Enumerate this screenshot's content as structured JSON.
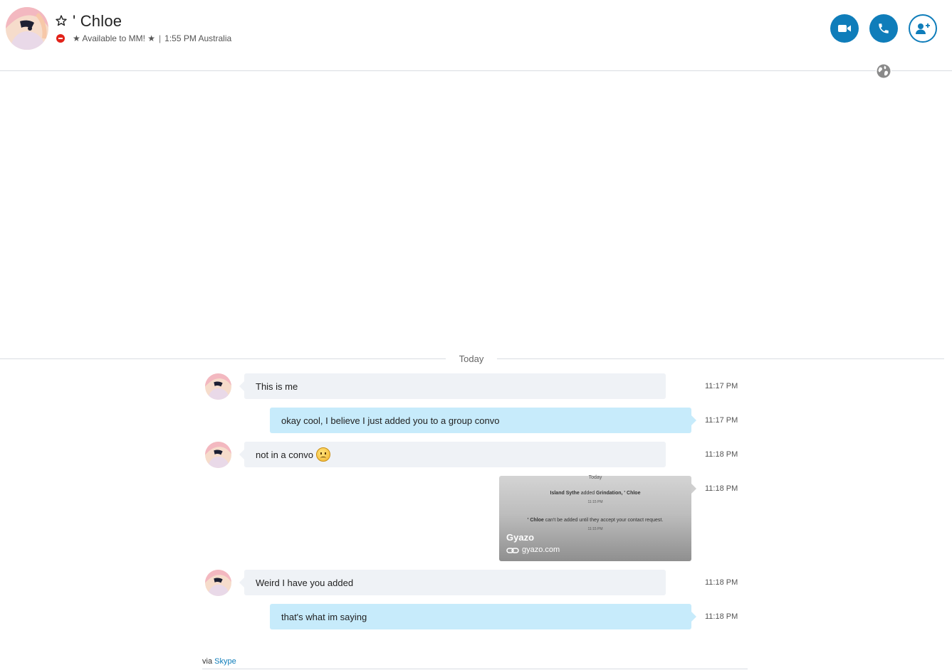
{
  "header": {
    "contact_name": "' Chloe",
    "mood": "★ Available to MM! ★",
    "separator": "|",
    "local_time": "1:55 PM Australia",
    "presence": "do-not-disturb",
    "buttons": [
      "video-call",
      "audio-call",
      "add-people"
    ]
  },
  "colors": {
    "accent": "#0f7dba",
    "incoming_bubble": "#eff2f6",
    "outgoing_bubble": "#c7ebfb",
    "presence_dnd": "#e2231a"
  },
  "conversation": {
    "day_label": "Today",
    "messages": [
      {
        "direction": "in",
        "text": "This is me",
        "time": "11:17 PM"
      },
      {
        "direction": "out",
        "text": "okay cool, I believe I just added you to a group convo",
        "time": "11:17 PM"
      },
      {
        "direction": "in",
        "text": "not in a convo",
        "emoticon": "sad-emoticon",
        "time": "11:18 PM"
      },
      {
        "direction": "out",
        "type": "link-preview",
        "title": "Gyazo",
        "domain": "gyazo.com",
        "time": "11:18 PM",
        "thumbnail": {
          "line1": "Today",
          "line2_a": "Island Sythe",
          "line2_b": "added",
          "line2_c": "Grindation",
          "line2_d": ", ' Chloe",
          "line3": "11:15 PM",
          "line4_a": "' Chloe",
          "line4_b": "can't be added until they accept your contact request.",
          "line5": "11:15 PM"
        }
      },
      {
        "direction": "in",
        "text": "Weird I have you added",
        "time": "11:18 PM"
      },
      {
        "direction": "out",
        "text": "that's what im saying",
        "time": "11:18 PM"
      }
    ]
  },
  "footer": {
    "via_prefix": "via",
    "via_link": "Skype"
  }
}
